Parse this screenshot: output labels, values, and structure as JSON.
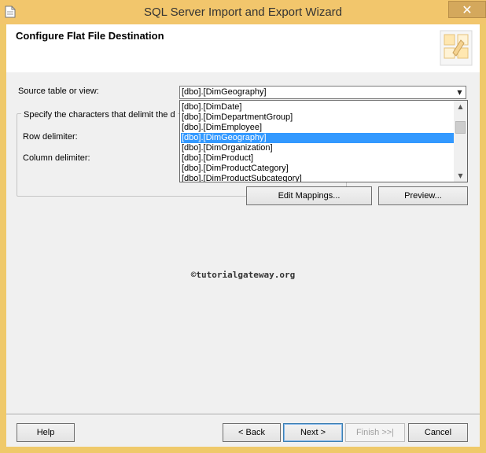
{
  "window": {
    "title": "SQL Server Import and Export Wizard",
    "close_glyph": "✕",
    "app_icon": "document-icon"
  },
  "header": {
    "title": "Configure Flat File Destination",
    "graphic_icon": "wizard-graphic-icon"
  },
  "form": {
    "source_label": "Source table or view:",
    "source_value": "[dbo].[DimGeography]",
    "group_caption": "Specify the characters that delimit the d",
    "row_delimiter_label": "Row delimiter:",
    "column_delimiter_label": "Column delimiter:",
    "dropdown_items": [
      "[dbo].[DimDate]",
      "[dbo].[DimDepartmentGroup]",
      "[dbo].[DimEmployee]",
      "[dbo].[DimGeography]",
      "[dbo].[DimOrganization]",
      "[dbo].[DimProduct]",
      "[dbo].[DimProductCategory]",
      "[dbo].[DimProductSubcategory]"
    ],
    "selected_item": "[dbo].[DimGeography]",
    "edit_mappings_label": "Edit Mappings...",
    "preview_label": "Preview..."
  },
  "watermark": "©tutorialgateway.org",
  "footer": {
    "help_label": "Help",
    "back_label": "< Back",
    "next_label": "Next >",
    "finish_label": "Finish >>|",
    "cancel_label": "Cancel"
  },
  "colors": {
    "titlebar": "#f2c66c",
    "selection": "#3399ff",
    "client_bg": "#f0f0f0"
  }
}
